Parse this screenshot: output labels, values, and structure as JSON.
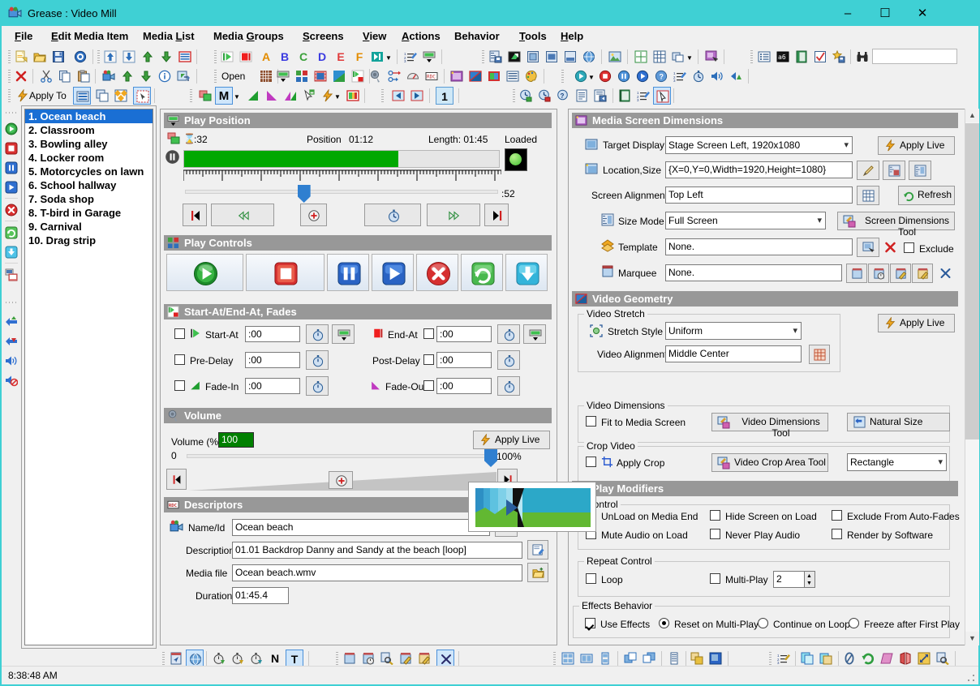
{
  "window": {
    "title": "Grease : Video Mill",
    "app_icon": "video-camera-icon",
    "minimize": "–",
    "maximize": "☐",
    "close": "✕",
    "titlebar_color": "#3fd0d4"
  },
  "menu": [
    {
      "label": "File",
      "accel": "F"
    },
    {
      "label": "Edit Media Item",
      "accel": "E"
    },
    {
      "label": "Media List",
      "accel": "L"
    },
    {
      "label": "Media Groups",
      "accel": "G"
    },
    {
      "label": "Screens",
      "accel": "S"
    },
    {
      "label": "View",
      "accel": "V"
    },
    {
      "label": "Actions",
      "accel": "A"
    },
    {
      "label": "Behavior",
      "accel": "B"
    },
    {
      "label": "Tools",
      "accel": "T"
    },
    {
      "label": "Help",
      "accel": "H"
    }
  ],
  "toolbar": {
    "open_label": "Open",
    "apply_to_label": "Apply To",
    "letters": [
      "A",
      "B",
      "C",
      "D",
      "E",
      "F"
    ],
    "m_label": "M",
    "page_number": "1",
    "n_label": "N",
    "t_label": "T"
  },
  "media_list": {
    "selected_index": 0,
    "items": [
      "1. Ocean beach",
      "2. Classroom",
      "3. Bowling alley",
      "4. Locker room",
      "5. Motorcycles on lawn",
      "6. School hallway",
      "7. Soda shop",
      "8. T-bird in Garage",
      "9. Carnival",
      "10. Drag strip"
    ]
  },
  "play_position": {
    "header": "Play Position",
    "elapsed": ":32",
    "position_label": "Position",
    "position_value": "01:12",
    "length_label": "Length: 01:45",
    "loaded_label": "Loaded",
    "progress_percent": 68,
    "slider_percent": 38,
    "slider_right_label": ":52",
    "buttons": [
      "skip-to-start-icon",
      "rewind-icon",
      "add-marker-icon",
      "timer-icon",
      "fast-forward-icon",
      "skip-to-end-icon"
    ]
  },
  "play_controls": {
    "header": "Play Controls",
    "buttons": [
      "play-icon",
      "stop-icon",
      "pause-icon",
      "resume-icon",
      "cancel-icon",
      "reload-icon",
      "load-icon"
    ]
  },
  "start_end_fades": {
    "header": "Start-At/End-At, Fades",
    "rows": [
      {
        "left_label": "Start-At",
        "left_value": ":00",
        "left_checked": false,
        "right_label": "End-At",
        "right_value": ":00",
        "right_checked": false
      },
      {
        "left_label": "Pre-Delay",
        "left_value": ":00",
        "left_checked": false,
        "right_label": "Post-Delay",
        "right_value": ":00",
        "right_checked": false
      },
      {
        "left_label": "Fade-In",
        "left_value": ":00",
        "left_checked": false,
        "right_label": "Fade-Out",
        "right_value": ":00",
        "right_checked": false
      }
    ]
  },
  "volume": {
    "header": "Volume",
    "label": "Volume (%)",
    "value": "100",
    "min_label": "0",
    "max_label": "100%",
    "apply_live": "Apply Live",
    "slider_percent": 100
  },
  "descriptors": {
    "header": "Descriptors",
    "name_label": "Name/Id",
    "name_value": "Ocean beach",
    "description_label": "Description",
    "description_value": "01.01  Backdrop Danny and Sandy at the beach [loop]",
    "mediafile_label": "Media file",
    "mediafile_value": "Ocean beach.wmv",
    "duration_label": "Duration",
    "duration_value": "01:45.4"
  },
  "media_screen_dimensions": {
    "header": "Media Screen Dimensions",
    "target_display_label": "Target Display",
    "target_display_value": "Stage Screen Left, 1920x1080",
    "location_size_label": "Location,Size",
    "location_size_value": "{X=0,Y=0,Width=1920,Height=1080}",
    "screen_alignment_label": "Screen Alignment",
    "screen_alignment_value": "Top Left",
    "size_mode_label": "Size Mode",
    "size_mode_value": "Full Screen",
    "template_label": "Template",
    "template_value": "None.",
    "marquee_label": "Marquee",
    "marquee_value": "None.",
    "apply_live": "Apply Live",
    "refresh": "Refresh",
    "screen_dimensions_tool": "Screen Dimensions Tool",
    "exclude_label": "Exclude",
    "exclude_checked": false
  },
  "video_geometry": {
    "header": "Video Geometry",
    "apply_live": "Apply Live",
    "stretch_group": "Video Stretch",
    "stretch_style_label": "Stretch Style",
    "stretch_style_value": "Uniform",
    "video_alignment_label": "Video Alignment",
    "video_alignment_value": "Middle Center",
    "dimensions_group": "Video Dimensions",
    "fit_to_media_screen_label": "Fit to Media Screen",
    "fit_to_media_screen_checked": false,
    "video_dimensions_tool": "Video Dimensions Tool",
    "natural_size": "Natural Size",
    "crop_group": "Crop Video",
    "apply_crop_label": "Apply Crop",
    "apply_crop_checked": false,
    "video_crop_area_tool": "Video Crop Area Tool",
    "crop_shape_value": "Rectangle"
  },
  "play_modifiers": {
    "header": "Play Modifiers",
    "control_group": "Control",
    "control_checks": [
      {
        "label": "UnLoad on Media End",
        "checked": false
      },
      {
        "label": "Hide Screen on Load",
        "checked": false
      },
      {
        "label": "Exclude From Auto-Fades",
        "checked": false
      },
      {
        "label": "Mute Audio on Load",
        "checked": false
      },
      {
        "label": "Never Play Audio",
        "checked": false
      },
      {
        "label": "Render by Software",
        "checked": false
      }
    ],
    "repeat_group": "Repeat Control",
    "loop_label": "Loop",
    "loop_checked": false,
    "multiplay_label": "Multi-Play",
    "multiplay_checked": false,
    "multiplay_value": "2",
    "effects_group": "Effects Behavior",
    "use_effects_label": "Use Effects",
    "use_effects_checked": true,
    "effects_options": [
      {
        "label": "Reset on Multi-Play",
        "selected": true
      },
      {
        "label": "Continue on Loop",
        "selected": false
      },
      {
        "label": "Freeze after First Play",
        "selected": false
      }
    ]
  },
  "status": {
    "time": "8:38:48 AM"
  }
}
